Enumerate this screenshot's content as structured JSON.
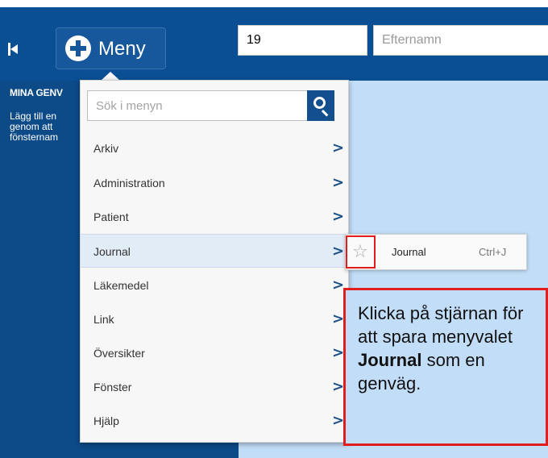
{
  "topbar": {
    "menu_button_label": "Meny",
    "personnummer_value": "19",
    "lastname_placeholder": "Efternamn"
  },
  "sidebar": {
    "title": "MINA GENV",
    "text_line1": "Lägg till en",
    "text_line2": "genom att",
    "text_line3": "fönsternam"
  },
  "dropdown": {
    "search_placeholder": "Sök i menyn",
    "items": [
      {
        "label": "Arkiv"
      },
      {
        "label": "Administration"
      },
      {
        "label": "Patient"
      },
      {
        "label": "Journal"
      },
      {
        "label": "Läkemedel"
      },
      {
        "label": "Link"
      },
      {
        "label": "Översikter"
      },
      {
        "label": "Fönster"
      },
      {
        "label": "Hjälp"
      }
    ],
    "chevron": ">"
  },
  "submenu": {
    "item_label": "Journal",
    "shortcut": "Ctrl+J",
    "star_glyph": "☆"
  },
  "callout": {
    "line1": "Klicka på stjärnan för att spara menyvalet",
    "bold": "Journal",
    "line2": "som en genväg."
  },
  "colors": {
    "topbar": "#0a4f93",
    "sidebar": "#0d4a88",
    "panel": "#c2ddf7",
    "highlight_border": "#e11d1d"
  },
  "icons": [
    "collapse-icon",
    "plus-circle-icon",
    "search-icon",
    "chevron-right-icon",
    "star-icon"
  ]
}
